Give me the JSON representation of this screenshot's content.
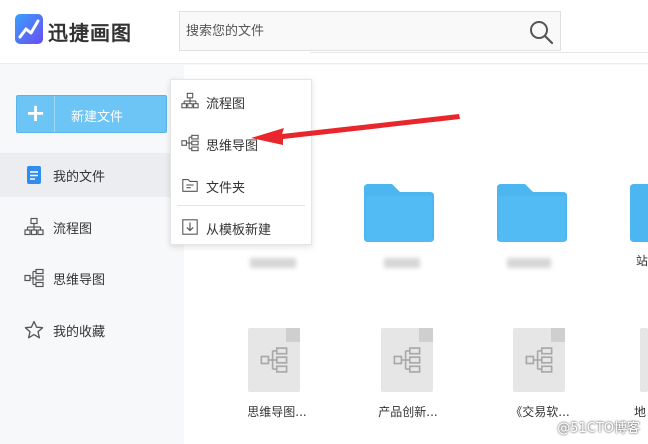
{
  "header": {
    "app_title": "迅捷画图",
    "search_placeholder": "搜索您的文件"
  },
  "sidebar": {
    "new_file_label": "新建文件",
    "items": [
      {
        "label": "我的文件",
        "icon": "document-icon",
        "active": true
      },
      {
        "label": "流程图",
        "icon": "flowchart-icon",
        "active": false
      },
      {
        "label": "思维导图",
        "icon": "mindmap-icon",
        "active": false
      },
      {
        "label": "我的收藏",
        "icon": "star-icon",
        "active": false
      }
    ]
  },
  "dropdown": {
    "items": [
      {
        "label": "流程图",
        "icon": "flowchart-icon"
      },
      {
        "label": "思维导图",
        "icon": "mindmap-icon"
      },
      {
        "label": "文件夹",
        "icon": "folder-icon"
      },
      {
        "label": "从模板新建",
        "icon": "template-icon"
      }
    ]
  },
  "files": {
    "folders": [
      {
        "name": ""
      },
      {
        "name": ""
      },
      {
        "name": "站"
      }
    ],
    "docs": [
      {
        "name": "思维导图..."
      },
      {
        "name": "产品创新..."
      },
      {
        "name": "《交易软..."
      },
      {
        "name": "地"
      }
    ]
  },
  "colors": {
    "accent": "#6cc5f5",
    "folder": "#4cb6f0",
    "arrow": "#e8262b"
  },
  "watermark": "@51CTO博客"
}
